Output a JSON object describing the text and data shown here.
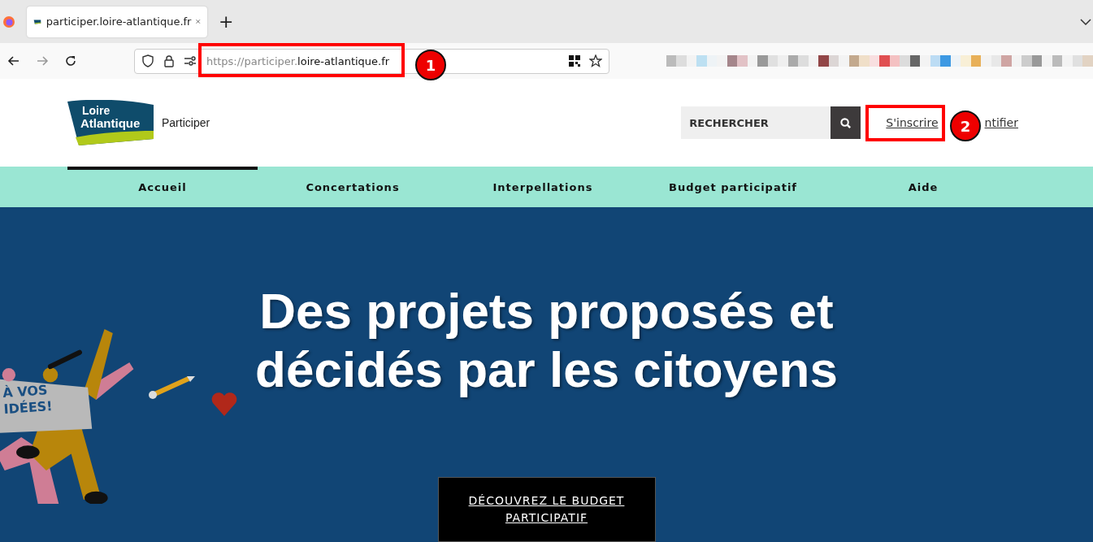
{
  "browser": {
    "tab": {
      "title": "participer.loire-atlantique.fr",
      "selected": true
    },
    "new_tab": "+",
    "url": {
      "scheme_and_sub": "https://participer.",
      "domain": "loire-atlantique.fr"
    }
  },
  "header": {
    "logo": {
      "line_1": "Loire",
      "line_2": "Atlantique"
    },
    "site_name": "Participer",
    "search": {
      "placeholder": "RECHERCHER"
    },
    "links": [
      {
        "label": "S'inscrire"
      },
      {
        "label": "ntifier"
      }
    ]
  },
  "nav": [
    {
      "label": "Accueil",
      "selected": true
    },
    {
      "label": "Concertations",
      "selected": false
    },
    {
      "label": "Interpellations",
      "selected": false
    },
    {
      "label": "Budget participatif",
      "selected": false
    },
    {
      "label": "Aide",
      "selected": false
    }
  ],
  "hero": {
    "title_lines": [
      "Des projets proposés et",
      "décidés par les citoyens"
    ],
    "banner_lines": [
      "À VOS",
      "IDÉES!"
    ],
    "button_lines": [
      "DÉCOUVREZ LE BUDGET",
      "PARTICIPATIF"
    ]
  },
  "annotations": [
    {
      "label": "1"
    },
    {
      "label": "2"
    }
  ]
}
